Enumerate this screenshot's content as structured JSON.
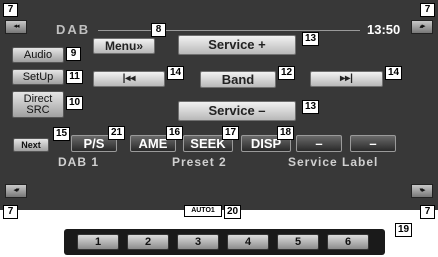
{
  "header": {
    "source_label": "DAB",
    "clock": "13:50"
  },
  "buttons": {
    "menu": "Menu»",
    "service_up": "Service +",
    "service_down": "Service –",
    "band": "Band",
    "prev_glyph": "|◂◂",
    "next_glyph": "▸▸|",
    "audio": "Audio",
    "setup": "SetUp",
    "direct_line1": "Direct",
    "direct_line2": "SRC",
    "next": "Next",
    "ps": "P/S",
    "ame": "AME",
    "seek": "SEEK",
    "disp": "DISP",
    "dash1": "–",
    "dash2": "–"
  },
  "info": {
    "band": "DAB 1",
    "preset": "Preset 2",
    "service_label": "Service Label"
  },
  "status": {
    "auto": "AUTO1"
  },
  "corners": {
    "top_left": "◂◂",
    "top_right": "▴▸",
    "bottom_left": "◂▾",
    "bottom_right": "▾▸"
  },
  "presets": [
    "1",
    "2",
    "3",
    "4",
    "5",
    "6"
  ],
  "callouts": {
    "c7a": "7",
    "c7b": "7",
    "c7c": "7",
    "c7d": "7",
    "c8": "8",
    "c9": "9",
    "c10": "10",
    "c11": "11",
    "c12": "12",
    "c13a": "13",
    "c13b": "13",
    "c14a": "14",
    "c14b": "14",
    "c15": "15",
    "c16": "16",
    "c17": "17",
    "c18": "18",
    "c19": "19",
    "c20": "20",
    "c21": "21"
  },
  "colors": {
    "screen_bg": "#383838",
    "button_light": "#e8e8e8",
    "text_light": "#d0d0d0"
  }
}
